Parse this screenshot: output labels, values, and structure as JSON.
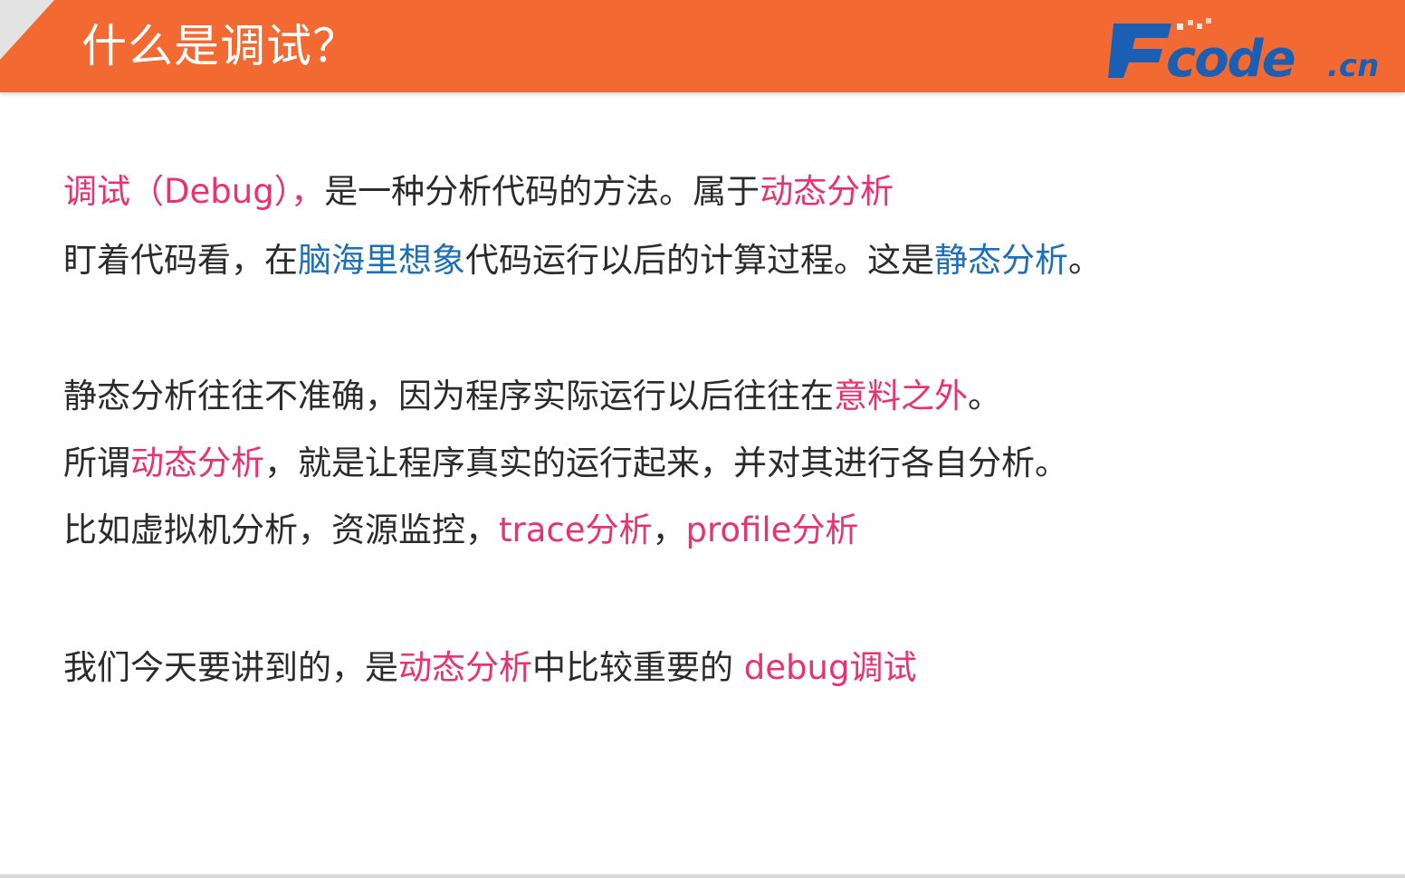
{
  "header": {
    "title": "什么是调试？",
    "logo_text": "Fcode.cn"
  },
  "colors": {
    "header_bg": "#f26a32",
    "highlight_pink": "#e8336f",
    "highlight_blue": "#1e6fb8",
    "body_text": "#2b2b2b",
    "logo_blue": "#1a5fb4"
  },
  "lines": [
    {
      "segments": [
        {
          "text": "调试（Debug），",
          "style": "pink"
        },
        {
          "text": "是一种分析代码的方法。属于",
          "style": "plain"
        },
        {
          "text": "动态分析",
          "style": "pink"
        }
      ]
    },
    {
      "segments": [
        {
          "text": "盯着代码看，在",
          "style": "plain"
        },
        {
          "text": "脑海里想象",
          "style": "blue"
        },
        {
          "text": "代码运行以后的计算过程。这是",
          "style": "plain"
        },
        {
          "text": "静态分析",
          "style": "blue"
        },
        {
          "text": "。",
          "style": "plain"
        }
      ]
    },
    {
      "segments": [
        {
          "text": "静态分析往往不准确，因为程序实际运行以后往往在",
          "style": "plain"
        },
        {
          "text": "意料之外",
          "style": "pink"
        },
        {
          "text": "。",
          "style": "plain"
        }
      ]
    },
    {
      "segments": [
        {
          "text": "所谓",
          "style": "plain"
        },
        {
          "text": "动态分析",
          "style": "pink"
        },
        {
          "text": "，就是让程序真实的运行起来，并对其进行各自分析。",
          "style": "plain"
        }
      ]
    },
    {
      "segments": [
        {
          "text": "比如虚拟机分析，资源监控，",
          "style": "plain"
        },
        {
          "text": "trace分析",
          "style": "pink"
        },
        {
          "text": "，",
          "style": "plain"
        },
        {
          "text": "profile分析",
          "style": "pink"
        }
      ]
    },
    {
      "segments": [
        {
          "text": "我们今天要讲到的，是",
          "style": "plain"
        },
        {
          "text": "动态分析",
          "style": "pink"
        },
        {
          "text": "中比较重要的 ",
          "style": "plain"
        },
        {
          "text": "debug调试",
          "style": "pink"
        }
      ]
    }
  ]
}
